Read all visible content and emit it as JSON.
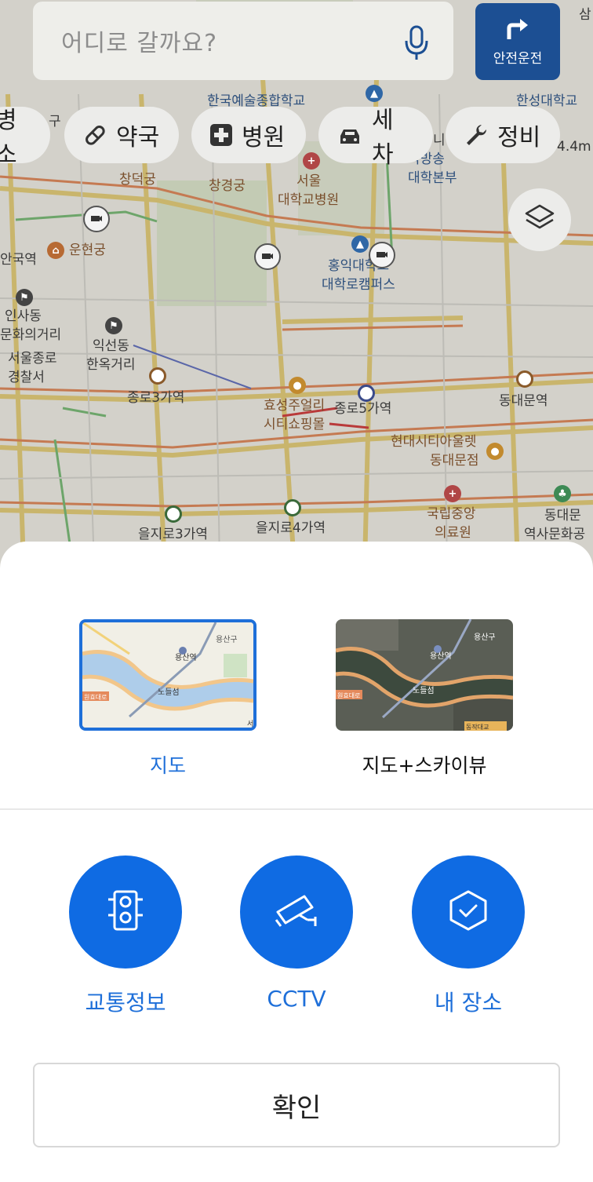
{
  "search": {
    "placeholder": "어디로 갈까요?"
  },
  "safe_drive": {
    "label": "안전운전"
  },
  "chips": [
    {
      "label": "병소"
    },
    {
      "label": "약국"
    },
    {
      "label": "병원"
    },
    {
      "label": "세차"
    },
    {
      "label": "정비"
    }
  ],
  "map_labels": {
    "school_top": "한국예술종합학교",
    "hansung": "한성대학교",
    "gu": "구",
    "changdeok": "창덕궁",
    "changgyeong": "창경궁",
    "snu_hospital_1": "서울",
    "snu_hospital_2": "대학교병원",
    "knou_1": "국방송",
    "knou_2": "대학본부",
    "ni": "니",
    "distance": "4.4m",
    "unhyeon": "운현궁",
    "anguk": "안국역",
    "insadong_1": "인사동",
    "insadong_2": "문화의거리",
    "jongno_police_1": "서울종로",
    "jongno_police_2": "경찰서",
    "ikseon_1": "익선동",
    "ikseon_2": "한옥거리",
    "hongik_1": "홍익대학교",
    "hongik_2": "대학로캠퍼스",
    "jongno3": "종로3가역",
    "hyosung_1": "효성주얼리",
    "hyosung_2": "시티쇼핑몰",
    "jongno5": "종로5가역",
    "dongdaemun_stn": "동대문역",
    "hyundai_1": "현대시티아울렛",
    "hyundai_2": "동대문점",
    "nmc_1": "국립중앙",
    "nmc_2": "의료원",
    "ddp_1": "동대문",
    "ddp_2": "역사문화공",
    "euljiro3": "을지로3가역",
    "euljiro4": "을지로4가역",
    "sam": "삼"
  },
  "sheet": {
    "map_types": [
      {
        "label": "지도",
        "selected": true
      },
      {
        "label": "지도+스카이뷰",
        "selected": false
      }
    ],
    "thumb_labels": {
      "yongsan_gu": "용산구",
      "yongsan_stn": "용산역",
      "nodeulseom": "노들섬",
      "wonhyo": "원효대로",
      "dongjak": "동작대교",
      "seo": "서"
    },
    "toggles": [
      {
        "label": "교통정보",
        "icon": "traffic-light-icon"
      },
      {
        "label": "CCTV",
        "icon": "cctv-icon"
      },
      {
        "label": "내 장소",
        "icon": "my-place-icon"
      }
    ],
    "confirm_label": "확인"
  },
  "colors": {
    "accent": "#0f6be3",
    "accent_text": "#1e6fd9",
    "safe_drive_bg": "#1c4f93"
  }
}
